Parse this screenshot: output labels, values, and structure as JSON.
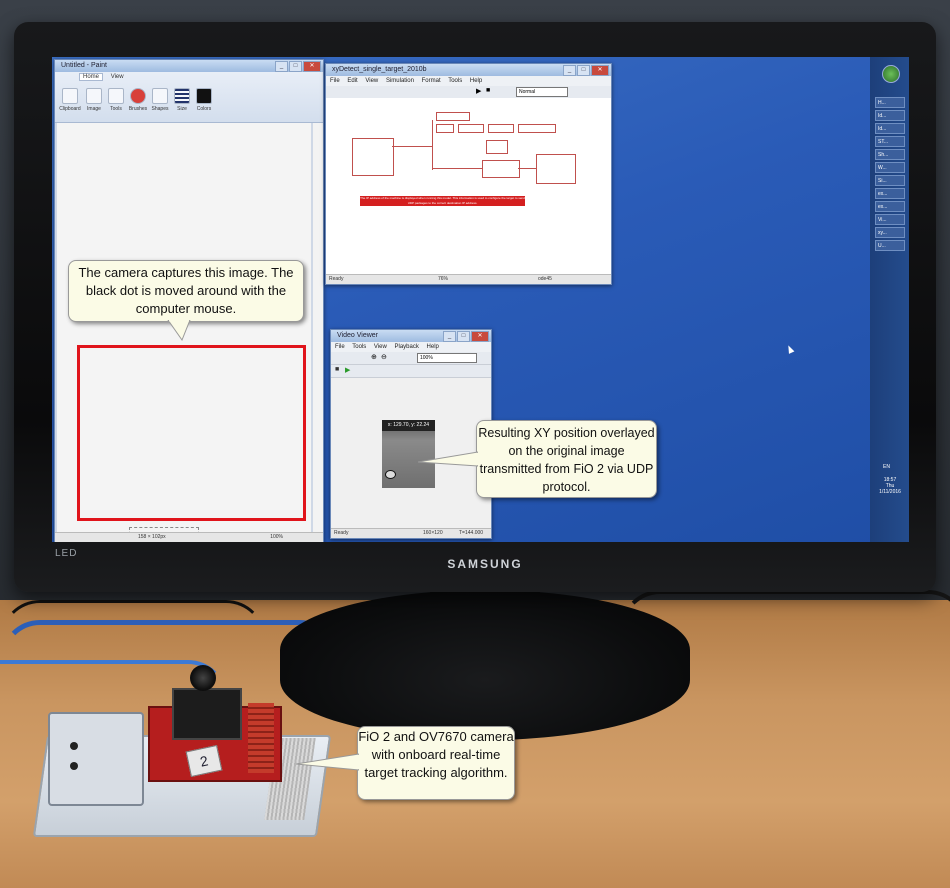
{
  "monitor": {
    "brand": "SAMSUNG",
    "led_logo": "LED"
  },
  "paint_window": {
    "title": "Untitled - Paint",
    "tabs": [
      "Home",
      "View"
    ],
    "ribbon_groups": [
      "Clipboard",
      "Image",
      "Tools",
      "Brushes",
      "Shapes",
      "Size",
      "Colors"
    ],
    "status_dims": "158 × 102px",
    "zoom": "100%"
  },
  "simulink_window": {
    "title": "xyDetect_single_target_2010b",
    "menu": [
      "File",
      "Edit",
      "View",
      "Simulation",
      "Format",
      "Tools",
      "Help"
    ],
    "sim_mode": "Normal",
    "status_left": "Ready",
    "status_zoom": "76%",
    "status_solver": "ode45",
    "error_text": "The IP address of the machine is displayed when running this model. This information is used to configure the target to send UDP packages to the correct destination IP address.",
    "blocks": [
      "Host UDP Receive",
      "Pointer Data",
      "Video Viewer",
      "Image",
      "xyDecode(u,x,y)"
    ]
  },
  "viewer_window": {
    "title": "Video Viewer",
    "menu": [
      "File",
      "Tools",
      "View",
      "Playback",
      "Help"
    ],
    "zoom": "100%",
    "overlay": "x: 129.70, y: 22.24",
    "status_left": "Ready",
    "status_frame": "160×120",
    "status_time": "T=144.000"
  },
  "taskbar": {
    "language": "EN",
    "time": "18:57",
    "day": "Thu",
    "date": "1/11/2016",
    "items": [
      "H...",
      "Id...",
      "Id...",
      "ST...",
      "Sh...",
      "W...",
      "Si...",
      "ex...",
      "ex...",
      "Vi...",
      "xy...",
      "U..."
    ]
  },
  "callouts": {
    "camera_capture": "The camera captures this image. The black dot is moved around with the computer mouse.",
    "xy_result": "Resulting XY position overlayed on the original image transmitted from FiO 2 via UDP protocol.",
    "fio_board": "FiO 2 and OV7670 camera with onboard real-time target tracking algorithm."
  },
  "hardware": {
    "cable_label": "2"
  },
  "colors": {
    "highlight_box": "#e0141b",
    "desktop": "#2a5bb7",
    "callout_bg": "#fbfbe6"
  }
}
